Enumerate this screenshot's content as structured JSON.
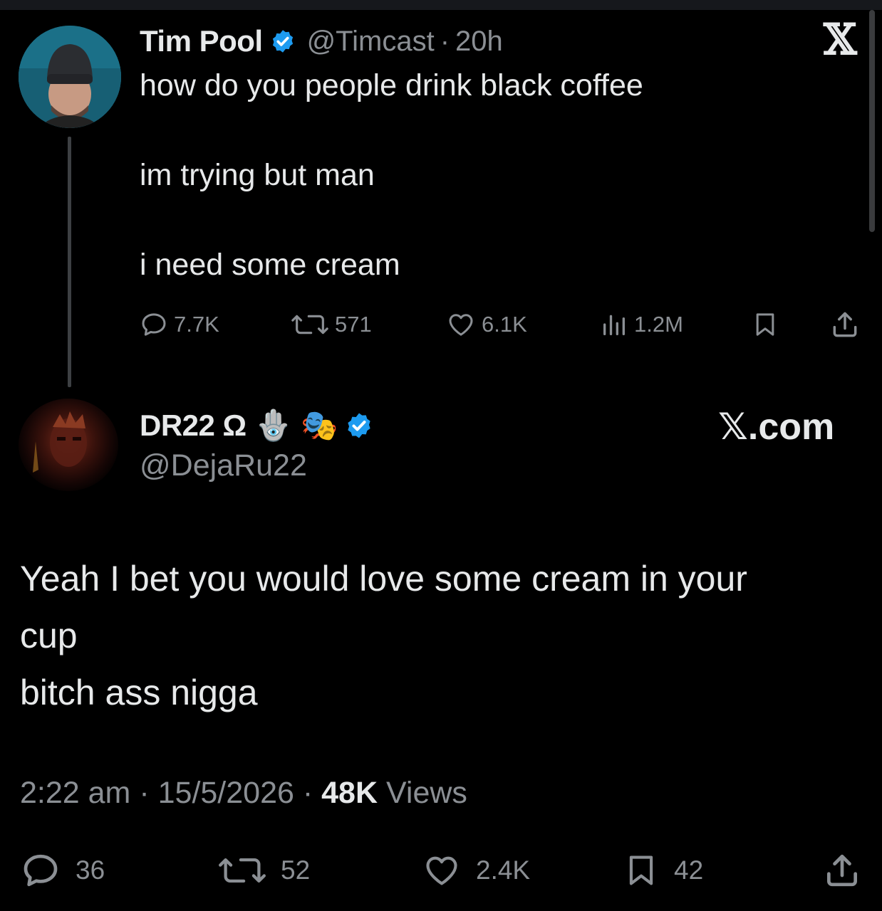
{
  "parent": {
    "name": "Tim Pool",
    "handle": "@Timcast",
    "separator": "·",
    "time": "20h",
    "lines": [
      "how do you people drink black coffee",
      "im trying but man",
      "i need some cream"
    ],
    "stats": {
      "replies": "7.7K",
      "reposts": "571",
      "likes": "6.1K",
      "views": "1.2M"
    },
    "logo": "𝕏"
  },
  "reply": {
    "name": "DR22 Ω",
    "emojis": [
      "🪬",
      "🎭"
    ],
    "handle": "@DejaRu22",
    "watermark": "𝕏.com",
    "lines": [
      "Yeah I bet you would love some cream in your",
      "cup",
      "bitch ass nigga"
    ],
    "time": "2:22 am",
    "date": "15/5/2026",
    "separator": "·",
    "views_count": "48K",
    "views_label": "Views",
    "stats": {
      "replies": "36",
      "reposts": "52",
      "likes": "2.4K",
      "bookmarks": "42"
    }
  },
  "icons": {
    "verified": "verified-badge-icon",
    "reply": "speech-bubble-icon",
    "repost": "repost-arrows-icon",
    "like": "heart-icon",
    "views": "bar-chart-icon",
    "bookmark": "bookmark-icon",
    "share": "share-upload-icon"
  },
  "colors": {
    "background": "#000000",
    "text": "#e7e9ea",
    "muted": "#8b8f94",
    "verified": "#1d9bf0"
  }
}
